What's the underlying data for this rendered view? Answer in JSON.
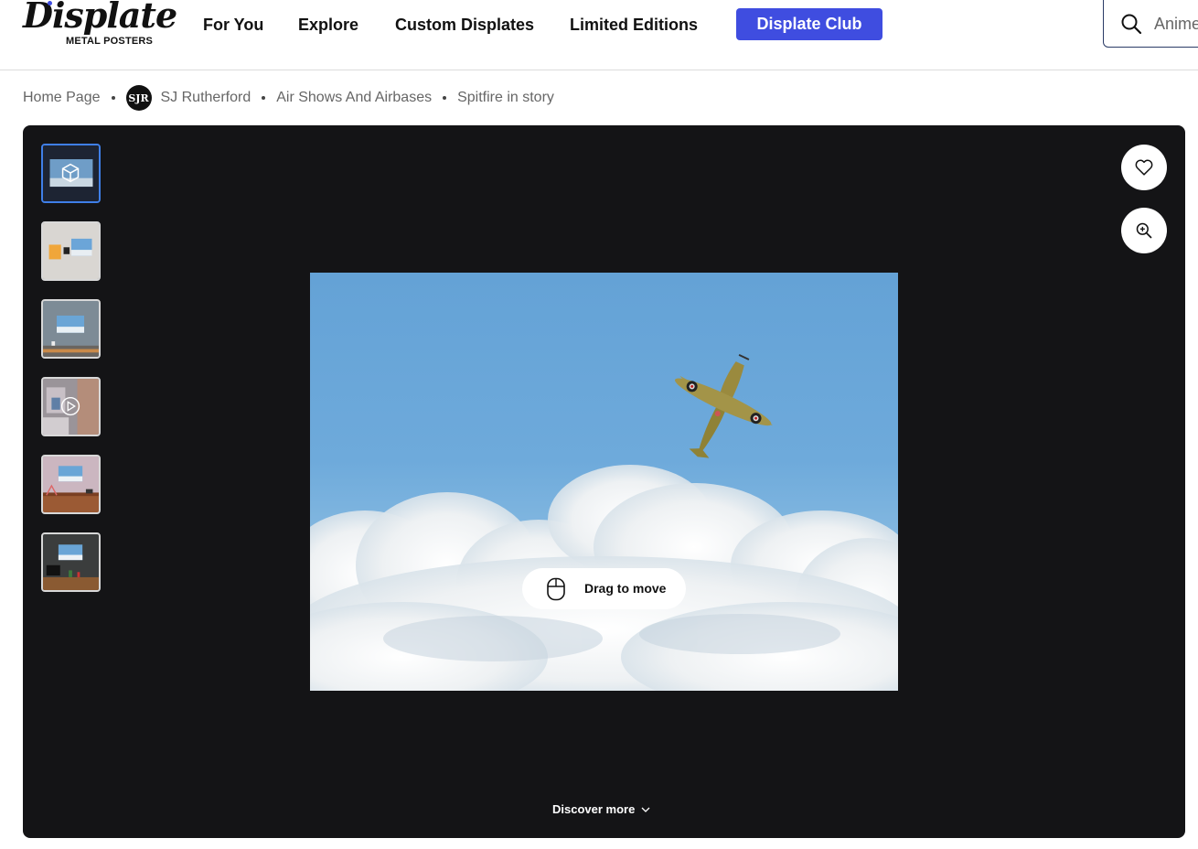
{
  "brand": {
    "name": "Displate",
    "tagline": "METAL POSTERS",
    "accent": "#3f4de0"
  },
  "nav": {
    "items": [
      {
        "label": "For You"
      },
      {
        "label": "Explore"
      },
      {
        "label": "Custom Displates"
      },
      {
        "label": "Limited Editions"
      }
    ],
    "club_label": "Displate Club"
  },
  "search": {
    "placeholder": "Anime"
  },
  "breadcrumb": {
    "home": "Home Page",
    "avatar_initials": "SJR",
    "artist": "SJ Rutherford",
    "collection": "Air Shows And Airbases",
    "current": "Spitfire in story"
  },
  "viewer": {
    "thumbnails": [
      {
        "name": "3d-view",
        "active": true
      },
      {
        "name": "wall-mockup-light"
      },
      {
        "name": "wall-mockup-grey"
      },
      {
        "name": "video-preview"
      },
      {
        "name": "room-mockup-pink"
      },
      {
        "name": "room-mockup-dark"
      }
    ],
    "drag_label": "Drag to move",
    "discover_label": "Discover more",
    "icons": {
      "favorite": "heart-icon",
      "zoom": "zoom-in-icon",
      "drag": "mouse-icon"
    }
  }
}
